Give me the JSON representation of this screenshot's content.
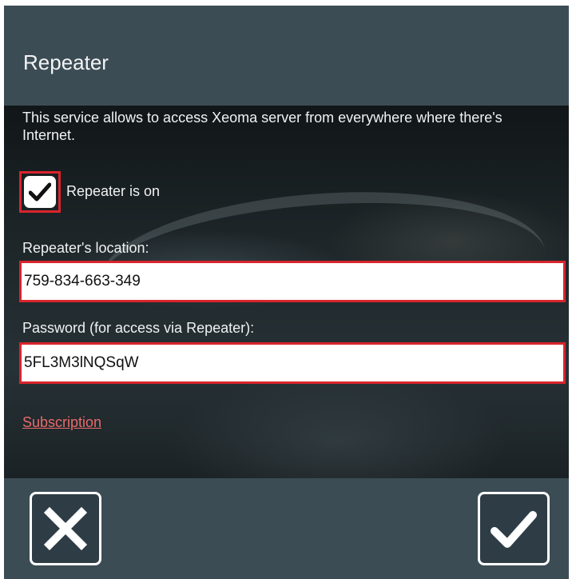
{
  "dialog": {
    "title": "Repeater",
    "description": "This service allows to access Xeoma server from everywhere where there's Internet."
  },
  "repeater_toggle": {
    "label": "Repeater is on",
    "checked": true,
    "icon": "checkmark-icon"
  },
  "location": {
    "label": "Repeater's location:",
    "value": "759-834-663-349"
  },
  "password": {
    "label": "Password (for access via Repeater):",
    "value": "5FL3M3lNQSqW"
  },
  "subscription": {
    "label": "Subscription"
  },
  "footer": {
    "cancel_icon": "close-icon",
    "ok_icon": "checkmark-icon"
  },
  "colors": {
    "highlight": "#d9242c",
    "link": "#e86a6a",
    "header_bg": "#3c4c54"
  }
}
